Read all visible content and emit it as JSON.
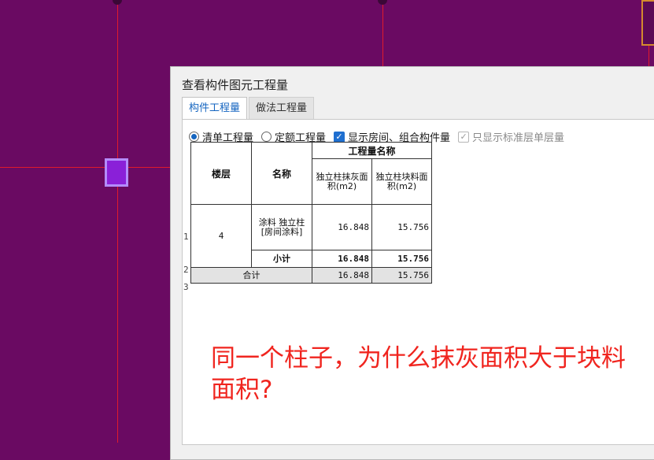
{
  "dialog": {
    "title": "查看构件图元工程量",
    "tabs": [
      {
        "label": "构件工程量",
        "active": true
      },
      {
        "label": "做法工程量",
        "active": false
      }
    ],
    "options": {
      "radio_bill": "清单工程量",
      "radio_quota": "定额工程量",
      "check_rooms": "显示房间、组合构件量",
      "check_std_floor": "只显示标准层单层量"
    },
    "table": {
      "group_header": "工程量名称",
      "col_floor": "楼层",
      "col_name": "名称",
      "col_plaster": "独立柱抹灰面积(m2)",
      "col_block": "独立柱块料面积(m2)",
      "rows": [
        {
          "num": "1",
          "floor": "4",
          "name": "涂料 独立柱[房间涂料]",
          "plaster": "16.848",
          "block": "15.756"
        },
        {
          "num": "2",
          "name": "小计",
          "plaster": "16.848",
          "block": "15.756"
        },
        {
          "num": "3",
          "name": "合计",
          "plaster": "16.848",
          "block": "15.756"
        }
      ]
    }
  },
  "annotation": "同一个柱子，为什么抹灰面积大于块料面积?"
}
